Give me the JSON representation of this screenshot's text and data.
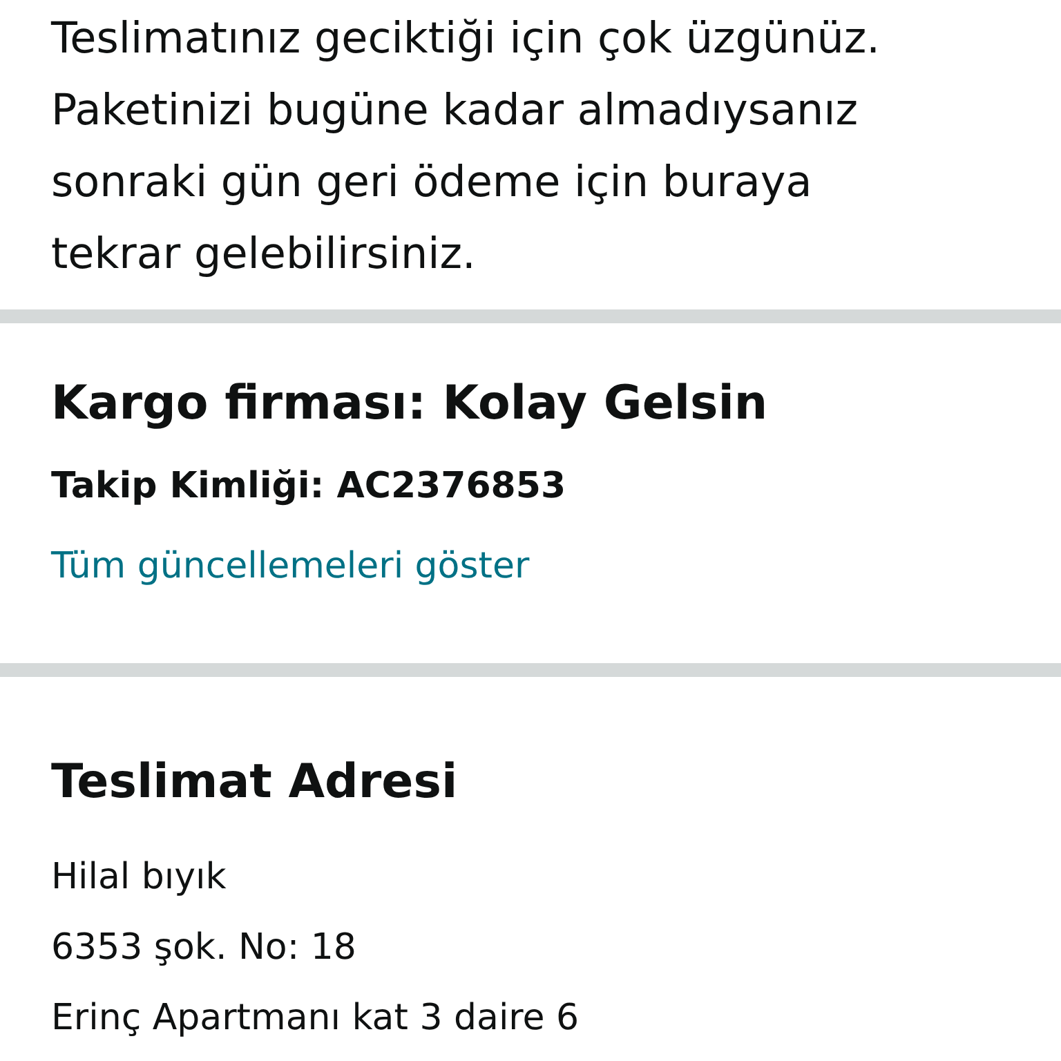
{
  "delay_message": {
    "text": "Teslimatınız geciktiği için çok üzgünüz. Paketinizi bugüne kadar almadıysanız sonraki gün geri ödeme için buraya tekrar gelebilirsiniz."
  },
  "shipping": {
    "carrier": "Kargo firması: Kolay Gelsin",
    "tracking_id": "Takip Kimliği: AC2376853",
    "link": "Tüm güncellemeleri göster"
  },
  "address": {
    "title": "Teslimat Adresi",
    "lines": [
      "Hilal bıyık",
      "6353 şok. No: 18",
      "Erinç Apartmanı kat 3 daire 6"
    ]
  }
}
